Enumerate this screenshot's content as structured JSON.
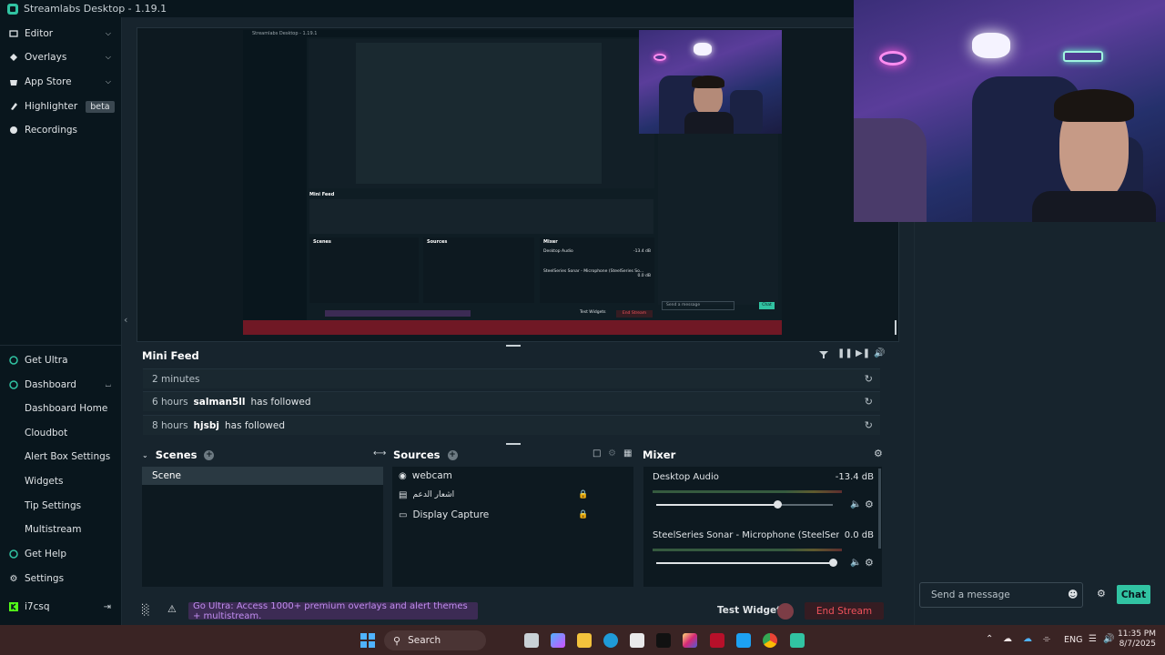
{
  "titlebar": {
    "title": "Streamlabs Desktop - 1.19.1"
  },
  "sidebar": {
    "top_items": [
      {
        "label": "Editor",
        "icon": "editor-icon"
      },
      {
        "label": "Overlays",
        "icon": "overlays-icon"
      },
      {
        "label": "App Store",
        "icon": "app-store-icon"
      },
      {
        "label": "Highlighter",
        "icon": "highlighter-icon",
        "badge": "beta"
      },
      {
        "label": "Recordings",
        "icon": "recordings-icon"
      }
    ],
    "get_ultra": "Get Ultra",
    "dashboard": "Dashboard",
    "dashboard_items": [
      "Dashboard Home",
      "Cloudbot",
      "Alert Box Settings",
      "Widgets",
      "Tip Settings",
      "Multistream"
    ],
    "get_help": "Get Help",
    "settings": "Settings",
    "user": "i7csq"
  },
  "minifeed": {
    "title": "Mini Feed",
    "rows": [
      {
        "time": "2 minutes",
        "name": "",
        "action": ""
      },
      {
        "time": "6 hours",
        "name": "salman5ll",
        "action": "has followed"
      },
      {
        "time": "8 hours",
        "name": "hjsbj",
        "action": "has followed"
      }
    ]
  },
  "scenes": {
    "title": "Scenes",
    "items": [
      "Scene"
    ]
  },
  "sources": {
    "title": "Sources",
    "items": [
      {
        "label": "webcam",
        "icon": "webcam-icon"
      },
      {
        "label": "اشعار الدعم",
        "icon": "alert-box-icon",
        "locked": true
      },
      {
        "label": "Display Capture",
        "icon": "monitor-icon",
        "locked": true
      }
    ]
  },
  "mixer": {
    "title": "Mixer",
    "channels": [
      {
        "name": "Desktop Audio",
        "db": "-13.4 dB",
        "level": 0.69
      },
      {
        "name": "SteelSeries Sonar - Microphone (SteelSeries So...",
        "db": "0.0 dB",
        "level": 1.0
      }
    ]
  },
  "bottombar": {
    "ultra_banner": "Go Ultra: Access 1000+ premium overlays and alert themes + multistream.",
    "test_widgets": "Test Widgets",
    "end_stream": "End Stream"
  },
  "chat": {
    "placeholder": "Send a message",
    "button": "Chat"
  },
  "taskbar": {
    "search": "Search",
    "lang": "ENG",
    "time": "11:35 PM",
    "date": "8/7/2025"
  },
  "nested_preview": {
    "title": "Streamlabs Desktop - 1.19.1",
    "minifeed_title": "Mini Feed",
    "scenes": "Scenes",
    "sources": "Sources",
    "mixer": "Mixer",
    "desktop_audio": "Desktop Audio",
    "desktop_db": "-13.4 dB",
    "mic": "SteelSeries Sonar - Microphone (SteelSeries So...",
    "mic_db": "0.0 dB",
    "end_stream": "End Stream",
    "chat": "Chat",
    "send": "Send a message",
    "test_widgets": "Test Widgets"
  }
}
